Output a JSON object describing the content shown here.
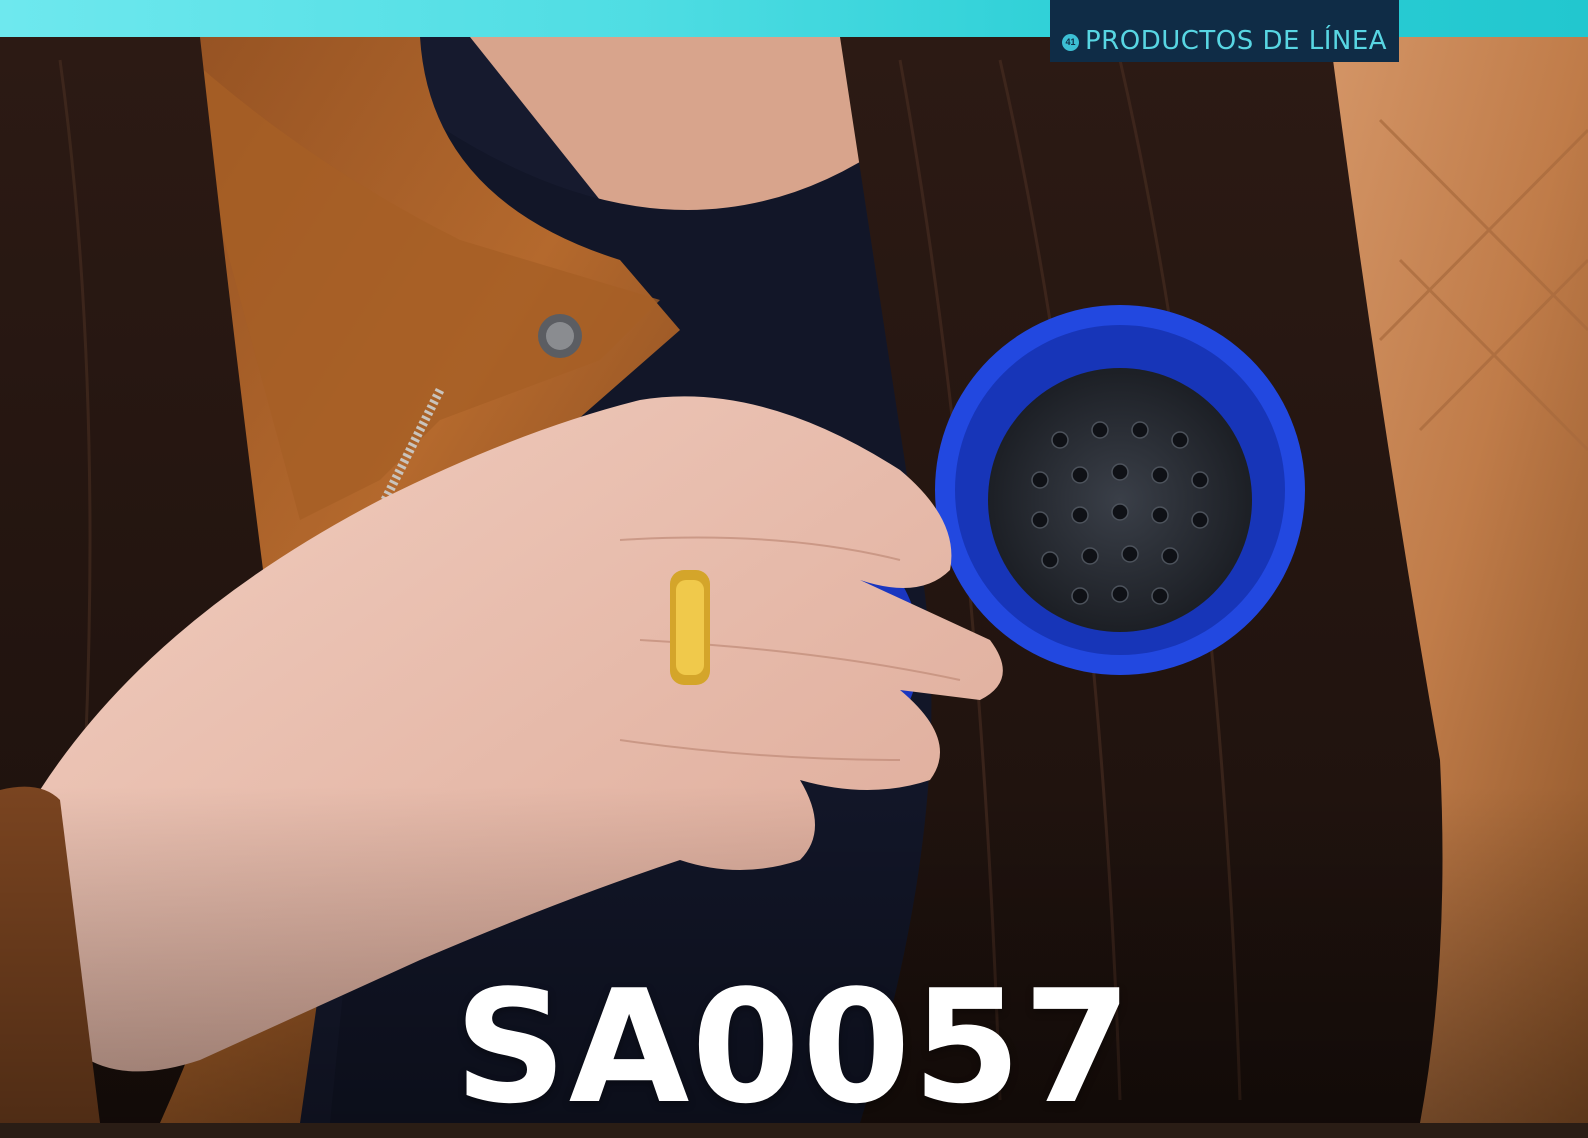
{
  "header": {
    "section_label": "PRODUCTOS DE LÍNEA",
    "section_icon": "circle-number-icon",
    "bar_color": "#4fdde3",
    "tab_color": "#0f2c46"
  },
  "product": {
    "code": "SA0057",
    "item_color": "#1f3fd6"
  }
}
